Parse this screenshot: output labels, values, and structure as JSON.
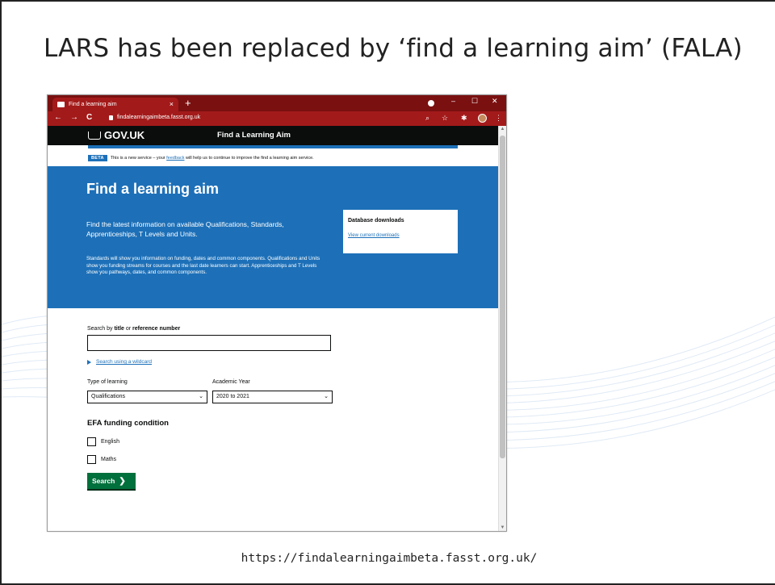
{
  "slide": {
    "title": "LARS has been replaced by ‘find a learning aim’ (FALA)",
    "footer_url": "https://findalearningaimbeta.fasst.org.uk/"
  },
  "browser": {
    "tab_title": "Find a learning aim",
    "tab_close": "×",
    "new_tab": "+",
    "url": "findalearningaimbeta.fasst.org.uk",
    "window_controls": [
      "–",
      "☐",
      "✕"
    ],
    "nav": {
      "back": "←",
      "forward": "→",
      "reload": "C"
    },
    "toolbar_icons": {
      "zoom": "⌕",
      "star": "☆",
      "extensions": "✱",
      "menu": "⋮"
    },
    "scroll_up": "▲",
    "scroll_down": "▼",
    "theme_color": "#a31a1a"
  },
  "page": {
    "header": {
      "logo": "GOV.UK",
      "service_name": "Find a Learning Aim"
    },
    "phase_banner": {
      "tag": "BETA",
      "text_before": "This is a new service – your ",
      "link": "feedback",
      "text_after": " will help us to continue to improve the find a learning aim service."
    },
    "hero": {
      "title": "Find a learning aim",
      "lead": "Find the latest information on available Qualifications, Standards, Apprenticeships, T Levels and Units.",
      "body": "Standards will show you information on funding, dates and common components. Qualifications and Units show you funding streams for courses and the last date learners can start. Apprenticeships and T Levels show you pathways, dates, and common components."
    },
    "downloads": {
      "title": "Database downloads",
      "link": "View current downloads"
    },
    "search": {
      "label_prefix": "Search by ",
      "label_title": "title",
      "label_or": " or ",
      "label_ref": "reference number",
      "value": "",
      "wildcard_link": "Search using a wildcard"
    },
    "type_of_learning": {
      "label": "Type of learning",
      "selected": "Qualifications"
    },
    "academic_year": {
      "label": "Academic Year",
      "selected": "2020 to 2021"
    },
    "efa": {
      "title": "EFA funding condition",
      "options": [
        {
          "label": "English",
          "checked": false
        },
        {
          "label": "Maths",
          "checked": false
        }
      ]
    },
    "search_button": "Search",
    "search_button_chevron": "❯",
    "colors": {
      "govuk_blue": "#1d70b8",
      "govuk_black": "#0b0c0c",
      "button_green": "#00703c"
    }
  }
}
